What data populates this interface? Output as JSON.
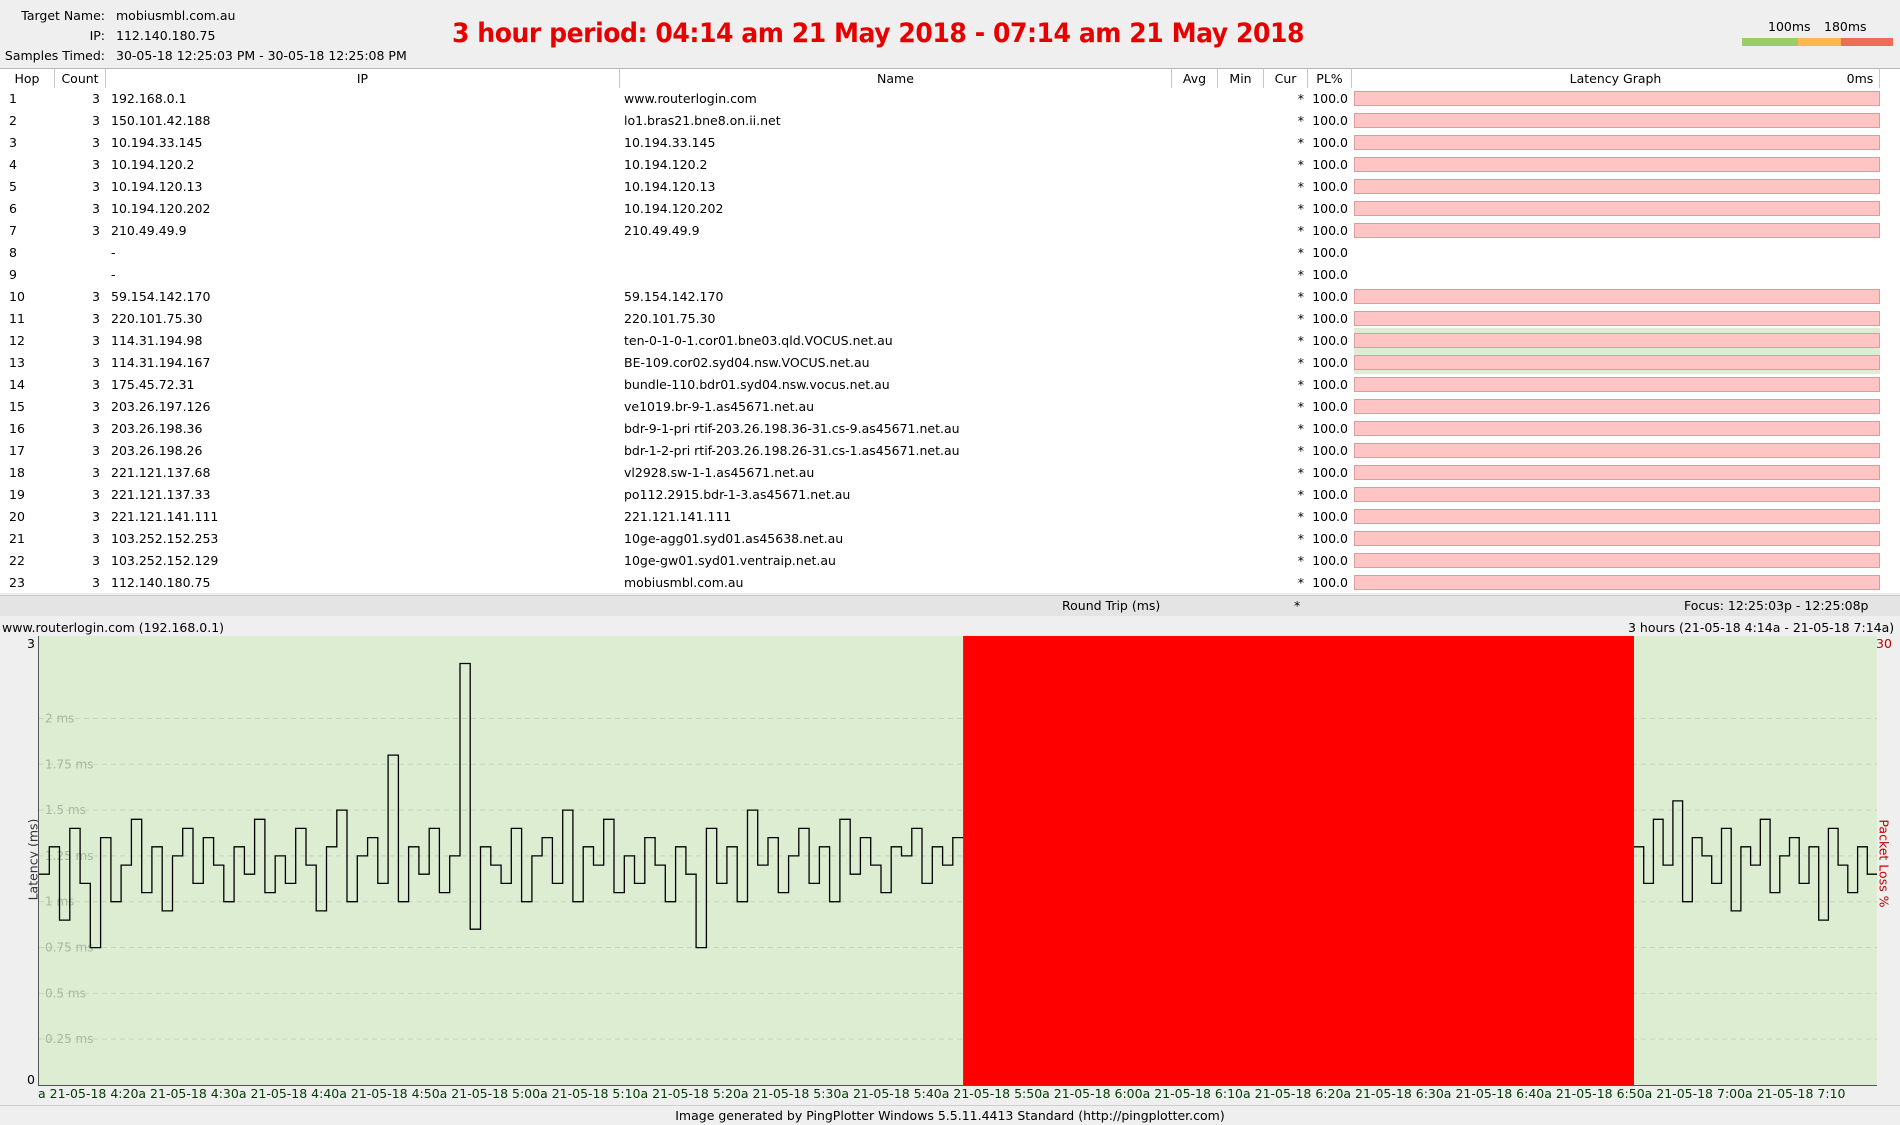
{
  "header": {
    "target_label": "Target Name:",
    "target_value": "mobiusmbl.com.au",
    "ip_label": "IP:",
    "ip_value": "112.140.180.75",
    "samples_label": "Samples Timed:",
    "samples_value": "30-05-18 12:25:03 PM - 30-05-18 12:25:08 PM",
    "title": "3 hour period:  04:14 am 21 May 2018 - 07:14 am 21 May 2018",
    "legend_100": "100ms",
    "legend_180": "180ms",
    "legend_colors": {
      "low": "#9ccc65",
      "mid": "#ffb74d",
      "high": "#ef6b5a"
    }
  },
  "table": {
    "columns": {
      "hop": "Hop",
      "count": "Count",
      "ip": "IP",
      "name": "Name",
      "avg": "Avg",
      "min": "Min",
      "cur": "Cur",
      "pl": "PL%",
      "graph": "Latency Graph",
      "graph_ms": "0ms"
    },
    "rows": [
      {
        "hop": "1",
        "count": "3",
        "ip": "192.168.0.1",
        "name": "www.routerlogin.com",
        "cur": "*",
        "pl": "100.0"
      },
      {
        "hop": "2",
        "count": "3",
        "ip": "150.101.42.188",
        "name": "lo1.bras21.bne8.on.ii.net",
        "cur": "*",
        "pl": "100.0"
      },
      {
        "hop": "3",
        "count": "3",
        "ip": "10.194.33.145",
        "name": "10.194.33.145",
        "cur": "*",
        "pl": "100.0"
      },
      {
        "hop": "4",
        "count": "3",
        "ip": "10.194.120.2",
        "name": "10.194.120.2",
        "cur": "*",
        "pl": "100.0"
      },
      {
        "hop": "5",
        "count": "3",
        "ip": "10.194.120.13",
        "name": "10.194.120.13",
        "cur": "*",
        "pl": "100.0"
      },
      {
        "hop": "6",
        "count": "3",
        "ip": "10.194.120.202",
        "name": "10.194.120.202",
        "cur": "*",
        "pl": "100.0"
      },
      {
        "hop": "7",
        "count": "3",
        "ip": "210.49.49.9",
        "name": "210.49.49.9",
        "cur": "*",
        "pl": "100.0"
      },
      {
        "hop": "8",
        "count": "",
        "ip": "-",
        "name": "",
        "cur": "*",
        "pl": "100.0"
      },
      {
        "hop": "9",
        "count": "",
        "ip": "-",
        "name": "",
        "cur": "*",
        "pl": "100.0"
      },
      {
        "hop": "10",
        "count": "3",
        "ip": "59.154.142.170",
        "name": "59.154.142.170",
        "cur": "*",
        "pl": "100.0"
      },
      {
        "hop": "11",
        "count": "3",
        "ip": "220.101.75.30",
        "name": "220.101.75.30",
        "cur": "*",
        "pl": "100.0"
      },
      {
        "hop": "12",
        "count": "3",
        "ip": "114.31.194.98",
        "name": "ten-0-1-0-1.cor01.bne03.qld.VOCUS.net.au",
        "cur": "*",
        "pl": "100.0"
      },
      {
        "hop": "13",
        "count": "3",
        "ip": "114.31.194.167",
        "name": "BE-109.cor02.syd04.nsw.VOCUS.net.au",
        "cur": "*",
        "pl": "100.0"
      },
      {
        "hop": "14",
        "count": "3",
        "ip": "175.45.72.31",
        "name": "bundle-110.bdr01.syd04.nsw.vocus.net.au",
        "cur": "*",
        "pl": "100.0"
      },
      {
        "hop": "15",
        "count": "3",
        "ip": "203.26.197.126",
        "name": "ve1019.br-9-1.as45671.net.au",
        "cur": "*",
        "pl": "100.0"
      },
      {
        "hop": "16",
        "count": "3",
        "ip": "203.26.198.36",
        "name": "bdr-9-1-pri rtif-203.26.198.36-31.cs-9.as45671.net.au",
        "cur": "*",
        "pl": "100.0"
      },
      {
        "hop": "17",
        "count": "3",
        "ip": "203.26.198.26",
        "name": "bdr-1-2-pri rtif-203.26.198.26-31.cs-1.as45671.net.au",
        "cur": "*",
        "pl": "100.0"
      },
      {
        "hop": "18",
        "count": "3",
        "ip": "221.121.137.68",
        "name": "vl2928.sw-1-1.as45671.net.au",
        "cur": "*",
        "pl": "100.0"
      },
      {
        "hop": "19",
        "count": "3",
        "ip": "221.121.137.33",
        "name": "po112.2915.bdr-1-3.as45671.net.au",
        "cur": "*",
        "pl": "100.0"
      },
      {
        "hop": "20",
        "count": "3",
        "ip": "221.121.141.111",
        "name": "221.121.141.111",
        "cur": "*",
        "pl": "100.0"
      },
      {
        "hop": "21",
        "count": "3",
        "ip": "103.252.152.253",
        "name": "10ge-agg01.syd01.as45638.net.au",
        "cur": "*",
        "pl": "100.0"
      },
      {
        "hop": "22",
        "count": "3",
        "ip": "103.252.152.129",
        "name": "10ge-gw01.syd01.ventraip.net.au",
        "cur": "*",
        "pl": "100.0"
      },
      {
        "hop": "23",
        "count": "3",
        "ip": "112.140.180.75",
        "name": "mobiusmbl.com.au",
        "cur": "*",
        "pl": "100.0"
      }
    ]
  },
  "roundtrip": {
    "label": "Round Trip (ms)",
    "cur": "*",
    "focus": "Focus: 12:25:03p - 12:25:08p"
  },
  "graph": {
    "host_label": "www.routerlogin.com (192.168.0.1)",
    "range_label": "3 hours (21-05-18 4:14a - 21-05-18 7:14a)",
    "y_axis_title": "Latency (ms)",
    "right_axis_title": "Packet Loss %",
    "y_top": "3",
    "y_bottom": "0",
    "right_top": "30",
    "y_ticks": [
      "2 ms",
      "1.75 ms",
      "1.5 ms",
      "1.25 ms",
      "1 ms",
      "0.75 ms",
      "0.5 ms",
      "0.25 ms"
    ],
    "x_labels": "a 21-05-18 4:20a 21-05-18 4:30a 21-05-18 4:40a 21-05-18 4:50a 21-05-18 5:00a 21-05-18 5:10a 21-05-18 5:20a 21-05-18 5:30a 21-05-18 5:40a 21-05-18 5:50a 21-05-18 6:00a 21-05-18 6:10a 21-05-18 6:20a 21-05-18 6:30a 21-05-18 6:40a 21-05-18 6:50a 21-05-18 7:00a 21-05-18 7:10",
    "colors": {
      "bg": "#dcedd2",
      "loss": "#ff0000",
      "line": "#000000"
    }
  },
  "chart_data": {
    "type": "line",
    "title": "",
    "xlabel": "",
    "ylabel": "Latency (ms)",
    "ylim": [
      0,
      2.3
    ],
    "x_range_minutes": [
      0,
      180
    ],
    "loss_region_minutes": [
      90.5,
      156.2
    ],
    "series": [
      {
        "values_note_start": 0,
        "values": [
          1.15,
          1.3,
          0.9,
          1.4,
          1.1,
          0.75,
          1.35,
          1.0,
          1.2,
          1.45,
          1.05,
          1.3,
          0.95,
          1.25,
          1.4,
          1.1,
          1.35,
          1.2,
          1.0,
          1.3,
          1.15,
          1.45,
          1.05,
          1.25,
          1.1,
          1.4,
          1.2,
          0.95,
          1.3,
          1.5,
          1.0,
          1.25,
          1.35,
          1.1,
          1.8,
          1.0,
          1.3,
          1.15,
          1.4,
          1.05,
          1.25,
          2.3,
          0.85,
          1.3,
          1.2,
          1.1,
          1.4,
          1.0,
          1.25,
          1.35,
          1.1,
          1.5,
          1.0,
          1.3,
          1.2,
          1.45,
          1.05,
          1.25,
          1.1,
          1.35,
          1.2,
          1.0,
          1.3,
          1.15,
          0.75,
          1.4,
          1.1,
          1.3,
          1.0,
          1.5,
          1.2,
          1.35,
          1.05,
          1.25,
          1.4,
          1.1,
          1.3,
          1.0,
          1.45,
          1.15,
          1.35,
          1.2,
          1.05,
          1.3,
          1.25,
          1.4,
          1.1,
          1.3,
          1.2,
          1.35
        ]
      },
      {
        "values_note_start": 156.2,
        "values": [
          1.3,
          1.1,
          1.45,
          1.2,
          1.55,
          1.0,
          1.35,
          1.25,
          1.1,
          1.4,
          0.95,
          1.3,
          1.2,
          1.45,
          1.05,
          1.25,
          1.35,
          1.1,
          1.3,
          0.9,
          1.4,
          1.2,
          1.05,
          1.3,
          1.15
        ]
      }
    ]
  },
  "footer": "Image generated by PingPlotter Windows 5.5.11.4413 Standard (http://pingplotter.com)"
}
